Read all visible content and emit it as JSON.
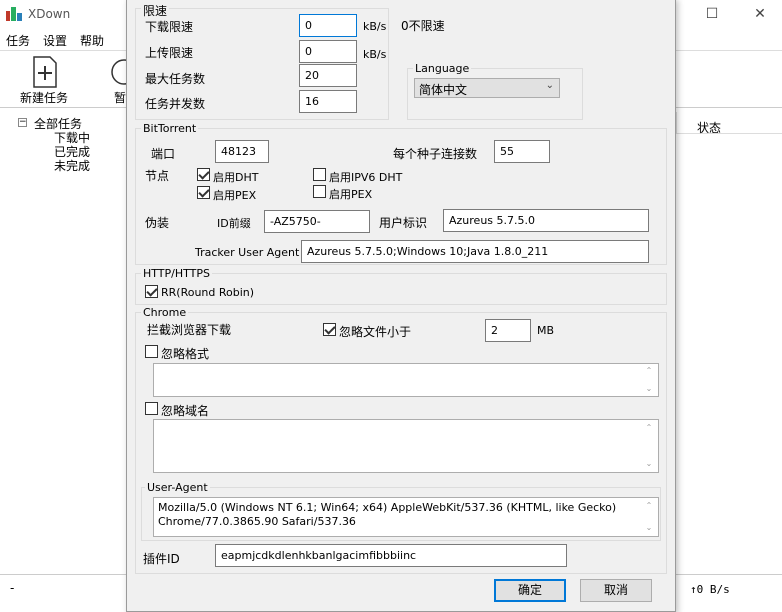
{
  "app": {
    "title": "XDown",
    "menu": [
      "任务",
      "设置",
      "帮助"
    ],
    "toolbar": {
      "new_task": "新建任务",
      "pause_partial": "暂"
    },
    "tree": {
      "root": "全部任务",
      "items": [
        "下载中",
        "已完成",
        "未完成"
      ]
    },
    "column_status": "状态",
    "statusbar": {
      "left": "-",
      "upload_speed": "↑0 B/s"
    }
  },
  "dialog": {
    "speed_limit": {
      "title": "限速",
      "download_label": "下载限速",
      "download_value": "0",
      "upload_label": "上传限速",
      "upload_value": "0",
      "unit": "kB/s",
      "no_limit_hint": "0不限速",
      "max_tasks_label": "最大任务数",
      "max_tasks_value": "20",
      "concurrency_label": "任务并发数",
      "concurrency_value": "16"
    },
    "language": {
      "title": "Language",
      "selected": "简体中文"
    },
    "bittorrent": {
      "title": "BitTorrent",
      "port_label": "端口",
      "port_value": "48123",
      "connections_label": "每个种子连接数",
      "connections_value": "55",
      "nodes_label": "节点",
      "enable_dht": "启用DHT",
      "enable_pex": "启用PEX",
      "enable_ipv6_dht": "启用IPV6 DHT",
      "enable_pex2": "启用PEX",
      "disguise_label": "伪装",
      "id_prefix_label": "ID前缀",
      "id_prefix_value": "-AZ5750-",
      "user_id_label": "用户标识",
      "user_id_value": "Azureus 5.7.5.0",
      "tracker_ua_label": "Tracker User Agent",
      "tracker_ua_value": "Azureus 5.7.5.0;Windows 10;Java 1.8.0_211"
    },
    "http": {
      "title": "HTTP/HTTPS",
      "rr_label": "RR(Round Robin)"
    },
    "chrome": {
      "title": "Chrome",
      "intercept_label": "拦截浏览器下载",
      "ignore_smaller_label": "忽略文件小于",
      "ignore_smaller_value": "2",
      "size_unit": "MB",
      "ignore_formats_label": "忽略格式",
      "ignore_domains_label": "忽略域名",
      "ua_title": "User-Agent",
      "ua_line1": "Mozilla/5.0 (Windows NT 6.1; Win64; x64) AppleWebKit/537.36 (KHTML, like Gecko)",
      "ua_line2": "Chrome/77.0.3865.90 Safari/537.36",
      "plugin_id_label": "插件ID",
      "plugin_id_value": "eapmjcdkdlenhkbanlgacimfibbbiinc"
    },
    "buttons": {
      "ok": "确定",
      "cancel": "取消"
    }
  },
  "colors": {
    "accent": "#0078d7",
    "dialog_bg": "#f0f0f0"
  }
}
